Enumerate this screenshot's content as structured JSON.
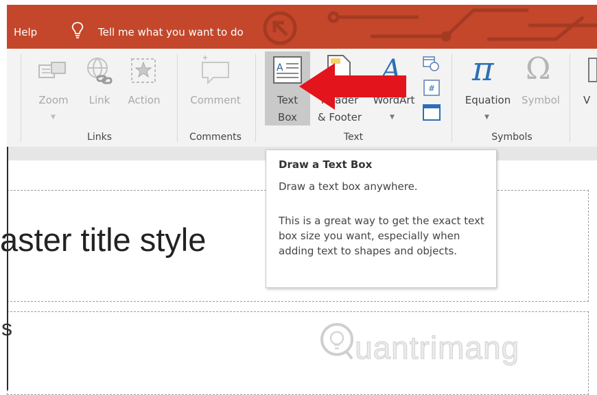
{
  "titlebar": {
    "help": "Help",
    "tell_me": "Tell me what you want to do",
    "bulb_icon": "lightbulb-icon",
    "color": "#c4472b"
  },
  "ribbon": {
    "links_group": {
      "label": "Links",
      "zoom": "Zoom",
      "link": "Link",
      "action": "Action"
    },
    "comments_group": {
      "label": "Comments",
      "comment": "Comment"
    },
    "text_group": {
      "label": "Text",
      "textbox_line1": "Text",
      "textbox_line2": "Box",
      "header_line1": "Header",
      "header_line2": "& Footer",
      "wordart": "WordArt"
    },
    "symbols_group": {
      "label": "Symbols",
      "equation": "Equation",
      "symbol": "Symbol",
      "pi": "π",
      "omega": "Ω"
    },
    "cutoff": "V"
  },
  "tooltip": {
    "title": "Draw a Text Box",
    "description": "Draw a text box anywhere.",
    "body": "This is a great way to get the exact text box size you want, especially when adding text to shapes and objects."
  },
  "slide": {
    "title_fragment": "aster title style",
    "body_fragment": "s"
  },
  "watermark": {
    "text": "uantrimang"
  },
  "colors": {
    "accent": "#c4472b",
    "arrow": "#e3141c",
    "selected": "#c9c9c9"
  }
}
